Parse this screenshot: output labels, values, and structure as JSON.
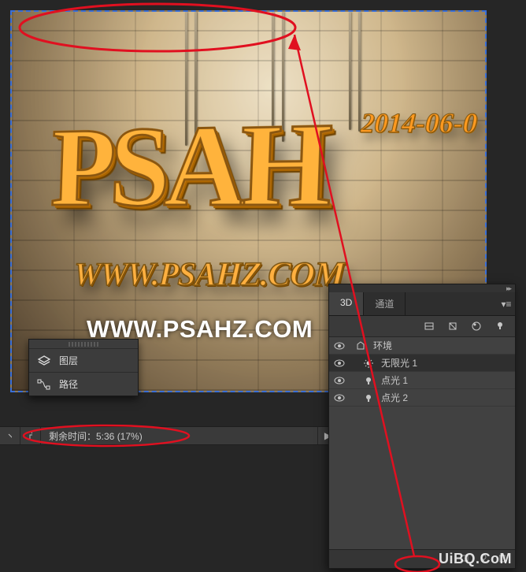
{
  "canvas": {
    "main_text": "PSAH",
    "sub_text": "WWW.PSAHZ.COM",
    "date_text": "2014-06-0",
    "overlay_url": "WWW.PSAHZ.COM"
  },
  "mini_panel": {
    "layers_label": "图层",
    "paths_label": "路径"
  },
  "status": {
    "remaining_label": "剩余时间：5:36 (17%)",
    "arrow_right": "▶"
  },
  "panel3d": {
    "tabs": {
      "tab1": "3D",
      "tab2": "通道"
    },
    "items": {
      "env": "环境",
      "infinite": "无限光 1",
      "point1": "点光 1",
      "point2": "点光 2"
    }
  },
  "watermark": "UiBQ.CoM"
}
